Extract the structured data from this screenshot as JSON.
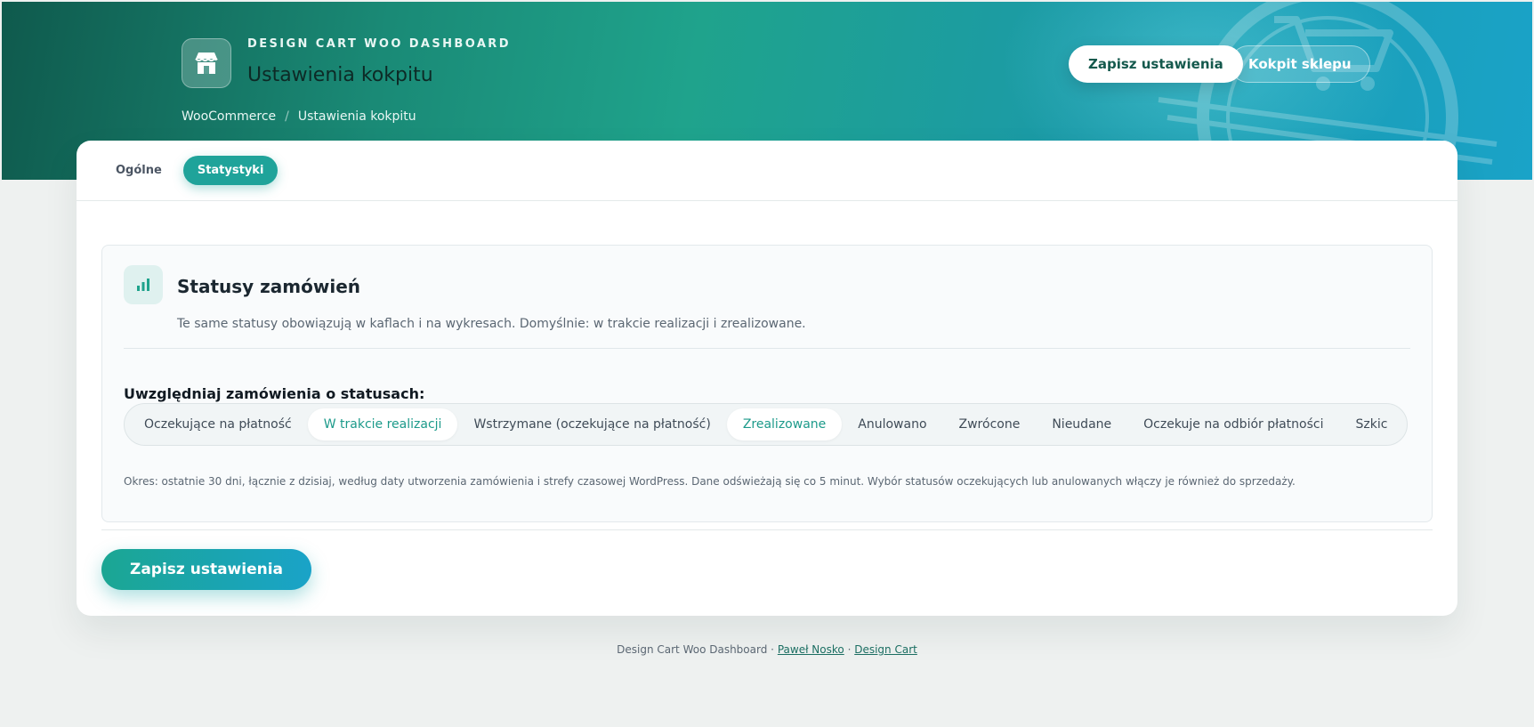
{
  "header": {
    "eyebrow": "DESIGN CART WOO DASHBOARD",
    "title": "Ustawienia kokpitu",
    "breadcrumb": [
      "WooCommerce",
      "Ustawienia kokpitu"
    ],
    "breadcrumb_sep": "/",
    "save_label": "Zapisz ustawienia",
    "shop_label": "Kokpit sklepu",
    "icon": "store-icon"
  },
  "tabs": [
    {
      "label": "Ogólne",
      "active": false
    },
    {
      "label": "Statystyki",
      "active": true
    }
  ],
  "panel": {
    "icon": "bar-chart-icon",
    "title": "Statusy zamówień",
    "description": "Te same statusy obowiązują w kaflach i na wykresach. Domyślnie: w trakcie realizacji i zrealizowane.",
    "field_label": "Uwzględniaj zamówienia o statusach:",
    "statuses": [
      {
        "label": "Oczekujące na płatność",
        "selected": false
      },
      {
        "label": "W trakcie realizacji",
        "selected": true
      },
      {
        "label": "Wstrzymane (oczekujące na płatność)",
        "selected": false
      },
      {
        "label": "Zrealizowane",
        "selected": true
      },
      {
        "label": "Anulowano",
        "selected": false
      },
      {
        "label": "Zwrócone",
        "selected": false
      },
      {
        "label": "Nieudane",
        "selected": false
      },
      {
        "label": "Oczekuje na odbiór płatności",
        "selected": false
      },
      {
        "label": "Szkic",
        "selected": false
      }
    ],
    "note": "Okres: ostatnie 30 dni, łącznie z dzisiaj, według daty utworzenia zamówienia i strefy czasowej WordPress. Dane odświeżają się co 5 minut. Wybór statusów oczekujących lub anulowanych włączy je również do sprzedaży."
  },
  "save_button_label": "Zapisz ustawienia",
  "footer": {
    "text": "Design Cart Woo Dashboard",
    "sep": "·",
    "author": "Paweł Nosko",
    "company": "Design Cart"
  },
  "colors": {
    "accent": "#1fa39a",
    "hero_start": "#0f5a4d",
    "hero_end": "#1aa3c8"
  }
}
